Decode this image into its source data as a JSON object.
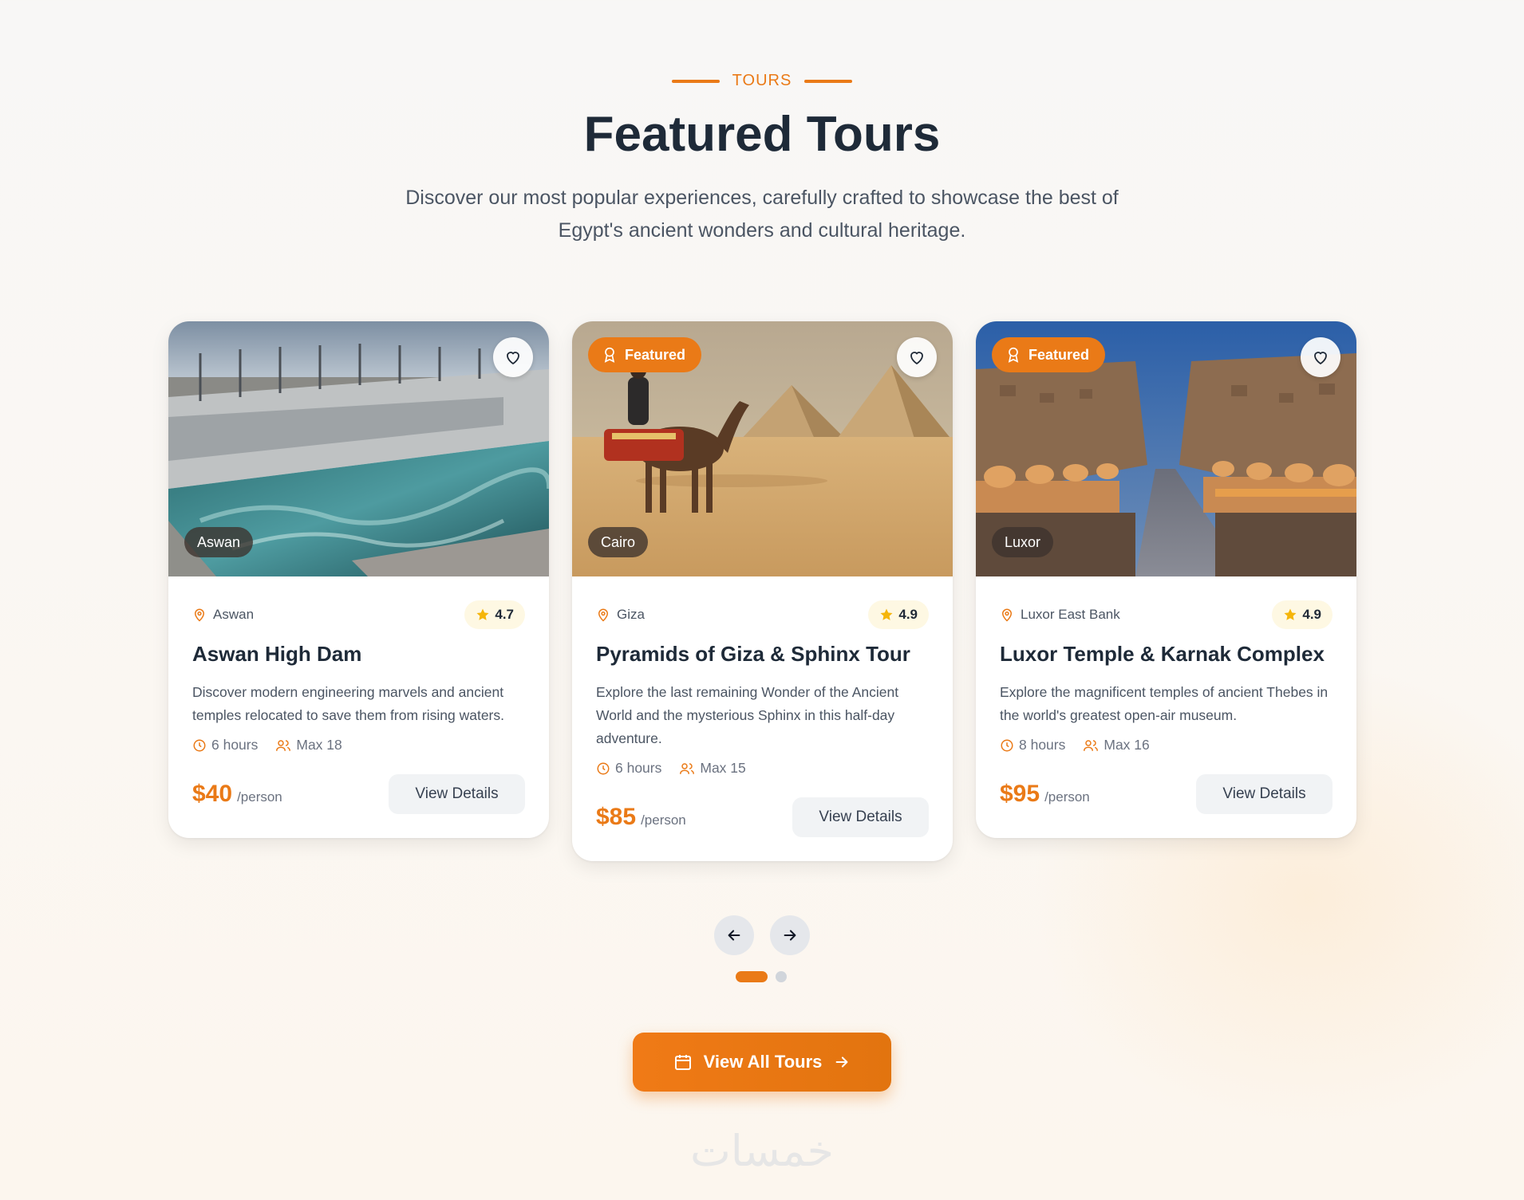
{
  "header": {
    "eyebrow": "TOURS",
    "title": "Featured Tours",
    "subtitle": "Discover our most popular experiences, carefully crafted to showcase the best of Egypt's ancient wonders and cultural heritage."
  },
  "tours": [
    {
      "city": "Aswan",
      "featured": false,
      "location": "Aswan",
      "rating": "4.7",
      "title": "Aswan High Dam",
      "description": "Discover modern engineering marvels and ancient temples relocated to save them from rising waters.",
      "duration": "6 hours",
      "group": "Max 18",
      "price": "$40",
      "per": "/person",
      "button": "View Details"
    },
    {
      "city": "Cairo",
      "featured": true,
      "featured_label": "Featured",
      "location": "Giza",
      "rating": "4.9",
      "title": "Pyramids of Giza & Sphinx Tour",
      "description": "Explore the last remaining Wonder of the Ancient World and the mysterious Sphinx in this half-day adventure.",
      "duration": "6 hours",
      "group": "Max 15",
      "price": "$85",
      "per": "/person",
      "button": "View Details"
    },
    {
      "city": "Luxor",
      "featured": true,
      "featured_label": "Featured",
      "location": "Luxor East Bank",
      "rating": "4.9",
      "title": "Luxor Temple & Karnak Complex",
      "description": "Explore the magnificent temples of ancient Thebes in the world's greatest open-air museum.",
      "duration": "8 hours",
      "group": "Max 16",
      "price": "$95",
      "per": "/person",
      "button": "View Details"
    }
  ],
  "carousel": {
    "prev_icon": "arrow-left-icon",
    "next_icon": "arrow-right-icon",
    "active_page": 1,
    "page_count": 2
  },
  "cta": {
    "label": "View All Tours"
  },
  "watermark": "خمسات",
  "colors": {
    "accent": "#ea7a17",
    "title": "#1e2a38",
    "star": "#f5b50a"
  }
}
